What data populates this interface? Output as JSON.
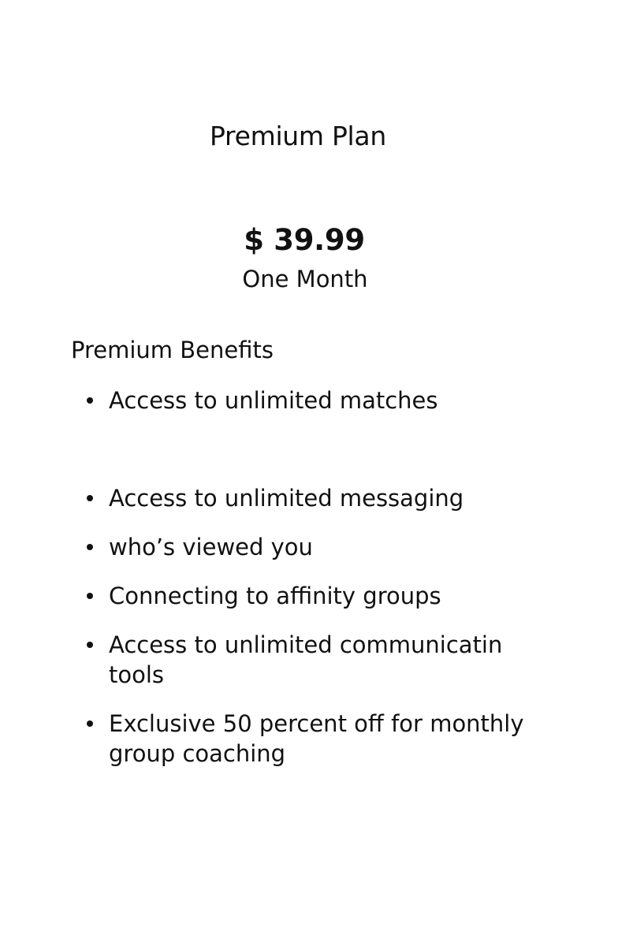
{
  "plan": {
    "title": "Premium Plan",
    "price": "$ 39.99",
    "period": "One Month"
  },
  "benefits": {
    "heading": "Premium Benefits",
    "items": [
      "Access to unlimited matches",
      "Access to unlimited messaging",
      "who’s viewed you",
      "Connecting to affinity groups",
      "Access to unlimited communicatin tools",
      "Exclusive 50 percent off for monthly group coaching"
    ]
  }
}
